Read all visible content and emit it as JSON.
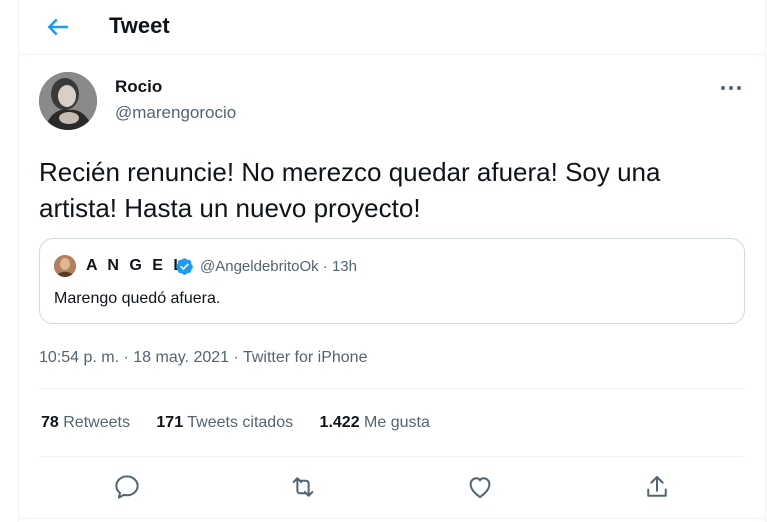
{
  "header": {
    "title": "Tweet",
    "back_icon": "arrow-left-icon",
    "accent": "#1d9bf0"
  },
  "tweet": {
    "author_name": "Rocio",
    "author_handle": "@marengorocio",
    "text": "Recién renuncie! No merezco quedar afuera! Soy una artista! Hasta un nuevo proyecto!",
    "timestamp": "10:54 p. m. · 18 may. 2021 · Twitter for iPhone"
  },
  "quote": {
    "author_name": "A N G E L",
    "handle_time": "@AngeldebritoOk · 13h",
    "text": "Marengo quedó afuera.",
    "verified_color": "#1d9bf0"
  },
  "stats": {
    "retweets_count": "78",
    "retweets_label": "Retweets",
    "quotes_count": "171",
    "quotes_label": "Tweets citados",
    "likes_count": "1.422",
    "likes_label": "Me gusta"
  },
  "actions": [
    "reply-icon",
    "retweet-icon",
    "like-icon",
    "share-icon"
  ]
}
